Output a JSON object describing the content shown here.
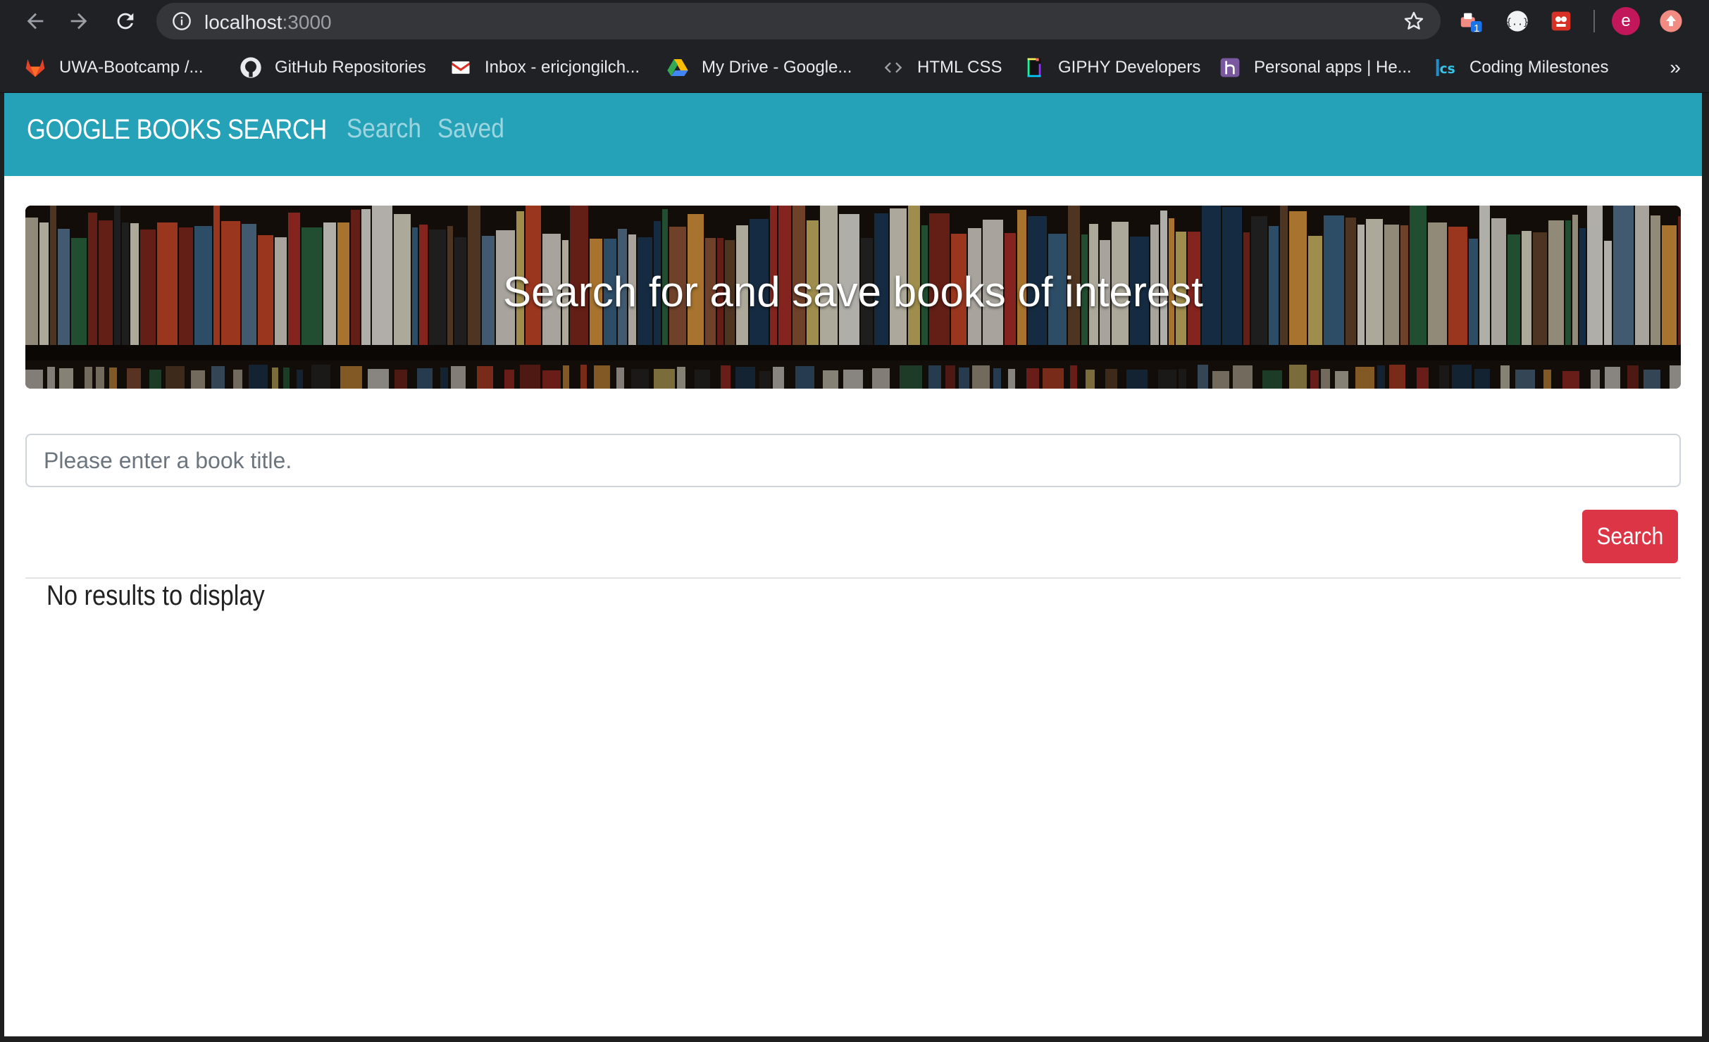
{
  "browser": {
    "url_host": "localhost",
    "url_port": ":3000",
    "profile_initial": "e",
    "extension_badge": "1",
    "bookmarks": [
      {
        "label": "UWA-Bootcamp /...",
        "icon": "gitlab-icon"
      },
      {
        "label": "GitHub Repositories",
        "icon": "github-icon"
      },
      {
        "label": "Inbox - ericjongilch...",
        "icon": "gmail-icon"
      },
      {
        "label": "My Drive - Google...",
        "icon": "google-drive-icon"
      },
      {
        "label": "HTML CSS",
        "icon": "code-icon"
      },
      {
        "label": "GIPHY Developers",
        "icon": "giphy-icon"
      },
      {
        "label": "Personal apps | He...",
        "icon": "heroku-icon"
      },
      {
        "label": "Coding Milestones",
        "icon": "cs-icon"
      }
    ],
    "bookmarks_more": "»"
  },
  "navbar": {
    "brand": "GOOGLE BOOKS SEARCH",
    "links": [
      "Search",
      "Saved"
    ]
  },
  "jumbotron": {
    "heading": "Search for and save books of interest"
  },
  "search": {
    "placeholder": "Please enter a book title.",
    "value": "",
    "button_label": "Search"
  },
  "results": {
    "empty_message": "No results to display"
  },
  "colors": {
    "navbar": "#25a2b8",
    "button": "#dc3545",
    "chrome": "#202124"
  }
}
